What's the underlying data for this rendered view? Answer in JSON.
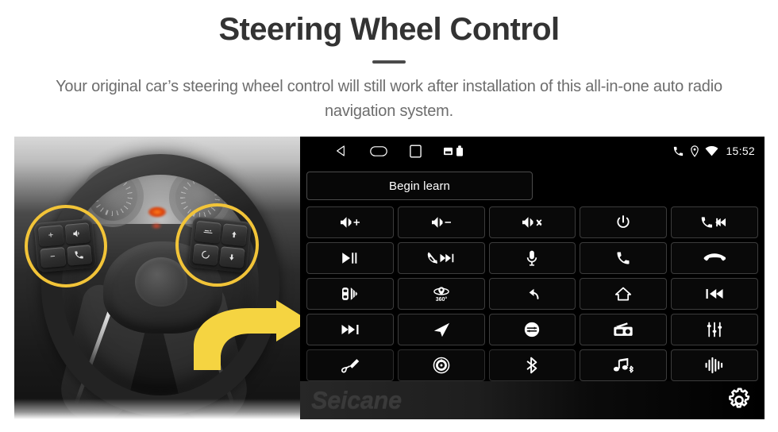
{
  "header": {
    "title": "Steering Wheel Control",
    "subtitle": "Your original car’s steering wheel control will still work after installation of this all-in-one auto radio navigation system."
  },
  "colors": {
    "highlight_yellow": "#F2C438",
    "arrow_yellow": "#F5D441",
    "title_gray": "#333333",
    "subtitle_gray": "#6D6D6D",
    "screen_black": "#000000",
    "cell_border": "#3C3C3C"
  },
  "photo": {
    "name": "steering-wheel-photograph",
    "description_icons": {
      "left_pod": [
        "volume-up-icon",
        "voice-command-icon",
        "volume-down-icon",
        "phone-call-icon"
      ],
      "right_pod": [
        "cruise-control-icon",
        "up-arrow-icon",
        "circle-set-icon",
        "down-arrow-icon"
      ]
    }
  },
  "headunit": {
    "statusbar": {
      "nav_icons": [
        "back-icon",
        "home-icon",
        "recents-icon"
      ],
      "system_icons": [
        "sd-card-icon",
        "usb-drive-icon"
      ],
      "right_icons": [
        "phone-icon",
        "location-icon",
        "wifi-icon"
      ],
      "clock": "15:52"
    },
    "begin_learn_label": "Begin learn",
    "buttons": [
      {
        "name": "volume-up-button",
        "icon": "volume-up",
        "label": ""
      },
      {
        "name": "volume-down-button",
        "icon": "volume-down",
        "label": ""
      },
      {
        "name": "mute-button",
        "icon": "volume-mute",
        "label": ""
      },
      {
        "name": "power-button",
        "icon": "power",
        "label": ""
      },
      {
        "name": "phone-previous-button",
        "icon": "phone-previous",
        "label": ""
      },
      {
        "name": "play-pause-button",
        "icon": "play-pause",
        "label": ""
      },
      {
        "name": "hangup-next-button",
        "icon": "hangup-next",
        "label": ""
      },
      {
        "name": "microphone-button",
        "icon": "microphone",
        "label": ""
      },
      {
        "name": "answer-call-button",
        "icon": "phone-answer",
        "label": ""
      },
      {
        "name": "end-call-button",
        "icon": "phone-hangup",
        "label": ""
      },
      {
        "name": "parking-radar-button",
        "icon": "parking-radar",
        "label": ""
      },
      {
        "name": "camera-360-button",
        "icon": "camera-360",
        "label": "360°"
      },
      {
        "name": "back-button",
        "icon": "back-arrow",
        "label": ""
      },
      {
        "name": "home-button",
        "icon": "home",
        "label": ""
      },
      {
        "name": "previous-track-button",
        "icon": "previous-track",
        "label": ""
      },
      {
        "name": "next-track-button",
        "icon": "next-track",
        "label": ""
      },
      {
        "name": "navigation-button",
        "icon": "navigation-arrow",
        "label": ""
      },
      {
        "name": "mode-switch-button",
        "icon": "mode-switch",
        "label": ""
      },
      {
        "name": "radio-button",
        "icon": "radio",
        "label": ""
      },
      {
        "name": "equalizer-button",
        "icon": "equalizer",
        "label": ""
      },
      {
        "name": "aux-input-button",
        "icon": "aux-cable",
        "label": ""
      },
      {
        "name": "disc-player-button",
        "icon": "disc",
        "label": ""
      },
      {
        "name": "bluetooth-button",
        "icon": "bluetooth",
        "label": ""
      },
      {
        "name": "bluetooth-music-button",
        "icon": "bluetooth-music",
        "label": ""
      },
      {
        "name": "voice-assistant-button",
        "icon": "voice-waveform",
        "label": ""
      }
    ],
    "brand": "Seicane",
    "settings_icon": "gear-icon"
  }
}
